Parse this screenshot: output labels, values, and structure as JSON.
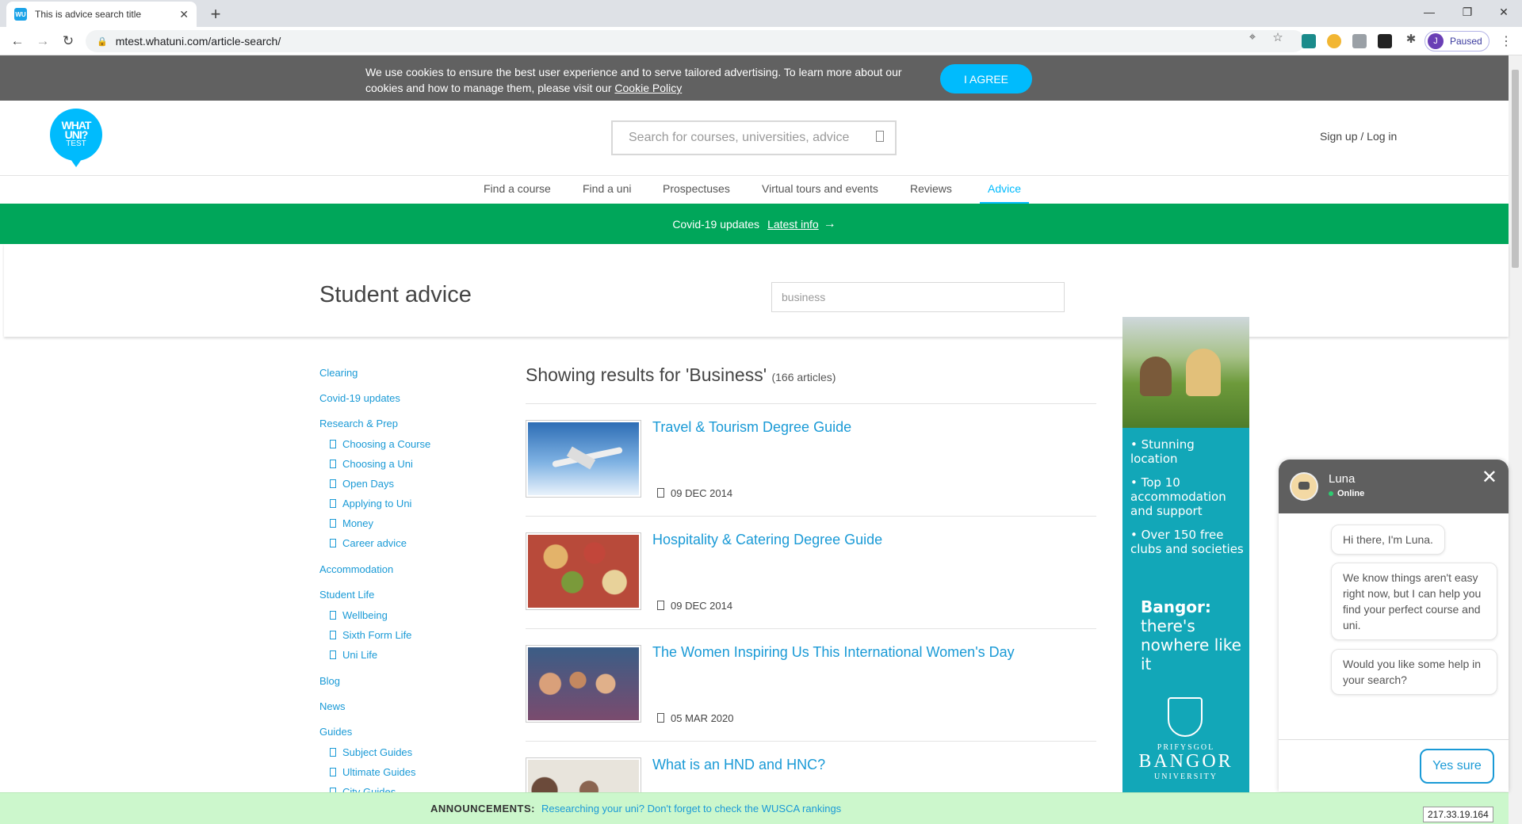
{
  "browser": {
    "tab_title": "This is advice search title",
    "favicon_text": "WU",
    "url": "mtest.whatuni.com/article-search/",
    "profile_initial": "J",
    "profile_status": "Paused",
    "new_tab": "+",
    "tab_close": "✕",
    "window_min": "—",
    "window_restore": "❐",
    "window_close": "✕",
    "back": "←",
    "forward": "→",
    "reload": "↻",
    "menu": "⋮"
  },
  "cookie": {
    "text": "We use cookies to ensure the best user experience and to serve tailored advertising. To learn more about our cookies and how to manage them, please visit our",
    "link": "Cookie Policy",
    "agree": "I AGREE"
  },
  "header": {
    "logo_line1": "WHAT",
    "logo_line2": "UNI?",
    "logo_line3": "TEST",
    "search_placeholder": "Search for courses, universities, advice",
    "signup": "Sign up / Log in"
  },
  "nav": [
    "Find a course",
    "Find a uni",
    "Prospectuses",
    "Virtual tours and events",
    "Reviews",
    "Advice"
  ],
  "covid": {
    "text": "Covid-19 updates",
    "link": "Latest info",
    "arrow": "→"
  },
  "advice": {
    "title": "Student advice",
    "search_value": "business"
  },
  "sidebar": {
    "clearing": "Clearing",
    "covid": "Covid-19 updates",
    "research": "Research & Prep",
    "research_subs": [
      "Choosing a Course",
      "Choosing a Uni",
      "Open Days",
      "Applying to Uni",
      "Money",
      "Career advice"
    ],
    "accommodation": "Accommodation",
    "student_life": "Student Life",
    "student_life_subs": [
      "Wellbeing",
      "Sixth Form Life",
      "Uni Life"
    ],
    "blog": "Blog",
    "news": "News",
    "guides": "Guides",
    "guides_subs": [
      "Subject Guides",
      "Ultimate Guides",
      "City Guides"
    ]
  },
  "results": {
    "heading": "Showing results for 'Business'",
    "count": "(166 articles)",
    "articles": [
      {
        "title": "Travel & Tourism Degree Guide",
        "date": "09 DEC 2014"
      },
      {
        "title": "Hospitality & Catering Degree Guide",
        "date": "09 DEC 2014"
      },
      {
        "title": "The Women Inspiring Us This International Women's Day",
        "date": "05 MAR 2020"
      },
      {
        "title": "What is an HND and HNC?",
        "date": ""
      }
    ]
  },
  "ad": {
    "bullets": [
      "• Stunning location",
      "• Top 10 accommodation and support",
      "• Over 150 free clubs and societies"
    ],
    "tag_bold": "Bangor:",
    "tag_rest": "there's nowhere like it",
    "uni_small1": "PRIFYSGOL",
    "uni_big": "BANGOR",
    "uni_small2": "UNIVERSITY"
  },
  "chat": {
    "name": "Luna",
    "status": "Online",
    "close": "✕",
    "messages": [
      "Hi there, I'm Luna.",
      "We know things aren't easy right now, but I can help you find your perfect course and uni.",
      "Would you like some help in your search?"
    ],
    "reply": "Yes sure"
  },
  "announcement": {
    "label": "ANNOUNCEMENTS:",
    "text": "Researching your uni? Don't forget to check the WUSCA rankings"
  },
  "ip": "217.33.19.164"
}
